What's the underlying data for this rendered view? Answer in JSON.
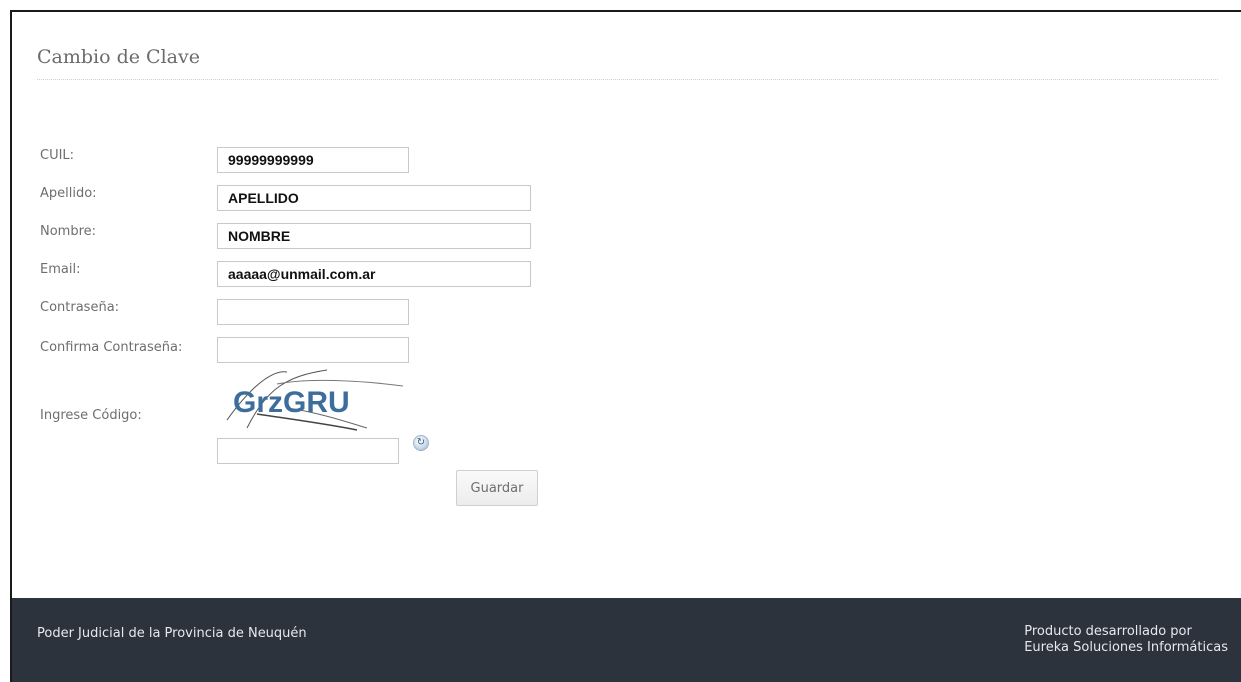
{
  "page": {
    "title": "Cambio de Clave"
  },
  "form": {
    "cuil": {
      "label": "CUIL:",
      "value": "99999999999"
    },
    "apellido": {
      "label": "Apellido:",
      "value": "APELLIDO"
    },
    "nombre": {
      "label": "Nombre:",
      "value": "NOMBRE"
    },
    "email": {
      "label": "Email:",
      "value": "aaaaa@unmail.com.ar"
    },
    "password": {
      "label": "Contraseña:",
      "value": ""
    },
    "confirm_password": {
      "label": "Confirma Contraseña:",
      "value": ""
    },
    "captcha": {
      "label": "Ingrese Código:",
      "image_text": "GrzGRU",
      "value": ""
    },
    "save_label": "Guardar"
  },
  "footer": {
    "left_text": "Poder Judicial de la Provincia de Neuquén",
    "right_line1": "Producto desarrollado por",
    "right_line2": "Eureka Soluciones Informáticas"
  },
  "colors": {
    "footer_bg": "#2c333d",
    "captcha_text": "#3d6d9c"
  }
}
